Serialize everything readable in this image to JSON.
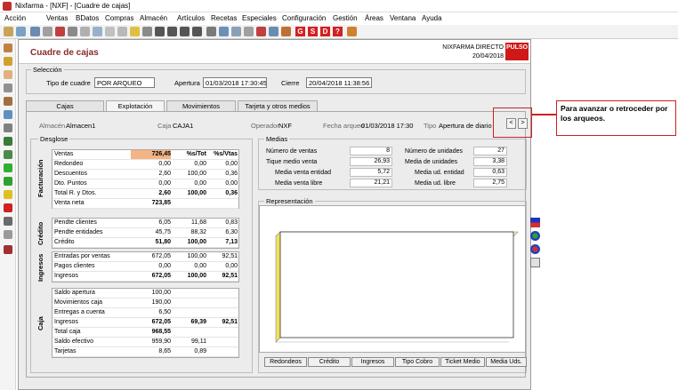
{
  "window": {
    "title": "Nixfarma - [NXF] - [Cuadre de cajas]"
  },
  "menu": [
    "Acción",
    "Ventas",
    "BDatos",
    "Compras",
    "Almacén",
    "Artículos",
    "Recetas",
    "Especiales",
    "Configuración",
    "Gestión",
    "Áreas",
    "Ventana",
    "Ayuda"
  ],
  "toolbar": {
    "red_buttons": [
      "G",
      "S",
      "D",
      "?"
    ]
  },
  "header": {
    "title": "Cuadre de cajas",
    "company": "NIXFARMA DIRECTO",
    "date": "20/04/2018",
    "logo": "PULSO"
  },
  "seleccion": {
    "legend": "Selección",
    "tipo_label": "Tipo de cuadre",
    "tipo_value": "POR ARQUEO",
    "apertura_label": "Apertura",
    "apertura_value": "01/03/2018 17:30:45",
    "cierre_label": "Cierre",
    "cierre_value": "20/04/2018 11:38:56"
  },
  "tabs": [
    "Cajas",
    "Explotación",
    "Movimientos",
    "Tarjeta y otros medios"
  ],
  "info": {
    "almacen_label": "Almacén",
    "almacen": "Almacen1",
    "caja_label": "Caja",
    "caja": "CAJA1",
    "operador_label": "Operador",
    "operador": "NXF",
    "fecha_label": "Fecha arqueo",
    "fecha": "01/03/2018 17:30",
    "tipo_label": "Tipo",
    "tipo": "Apertura de diario"
  },
  "nav": {
    "prev": "<",
    "next": ">"
  },
  "callout": {
    "text": "Para avanzar o retroceder por los arqueos."
  },
  "desglose": {
    "legend": "Desglose",
    "columns": [
      "%s/Tot",
      "%s/Vtas"
    ],
    "groups": {
      "facturacion": {
        "label": "Facturación",
        "rows": [
          {
            "name": "Ventas",
            "v1": "726,45",
            "v2": "",
            "v3": ""
          },
          {
            "name": "Redondeo",
            "v1": "0,00",
            "v2": "0,00",
            "v3": "0,00"
          },
          {
            "name": "Descuentos",
            "v1": "2,60",
            "v2": "100,00",
            "v3": "0,36"
          },
          {
            "name": "Dto. Puntos",
            "v1": "0,00",
            "v2": "0,00",
            "v3": "0,00"
          },
          {
            "name": "Total R. y Dtos.",
            "v1": "2,60",
            "v2": "100,00",
            "v3": "0,36"
          },
          {
            "name": "Venta neta",
            "v1": "723,85",
            "v2": "",
            "v3": ""
          }
        ]
      },
      "credito": {
        "label": "Crédito",
        "rows": [
          {
            "name": "Pendte clientes",
            "v1": "6,05",
            "v2": "11,68",
            "v3": "0,83"
          },
          {
            "name": "Pendte entidades",
            "v1": "45,75",
            "v2": "88,32",
            "v3": "6,30"
          },
          {
            "name": "Crédito",
            "v1": "51,80",
            "v2": "100,00",
            "v3": "7,13"
          }
        ]
      },
      "ingresos": {
        "label": "Ingresos",
        "rows": [
          {
            "name": "Entradas por ventas",
            "v1": "672,05",
            "v2": "100,00",
            "v3": "92,51"
          },
          {
            "name": "Pagos clientes",
            "v1": "0,00",
            "v2": "0,00",
            "v3": "0,00"
          },
          {
            "name": "Ingresos",
            "v1": "672,05",
            "v2": "100,00",
            "v3": "92,51"
          }
        ]
      },
      "caja": {
        "label": "Caja",
        "rows": [
          {
            "name": "Saldo apertura",
            "v1": "100,00",
            "v2": "",
            "v3": ""
          },
          {
            "name": "Movimientos caja",
            "v1": "190,00",
            "v2": "",
            "v3": ""
          },
          {
            "name": "Entregas a cuenta",
            "v1": "6,50",
            "v2": "",
            "v3": ""
          },
          {
            "name": "Ingresos",
            "v1": "672,05",
            "v2": "69,39",
            "v3": "92,51"
          },
          {
            "name": "Total caja",
            "v1": "968,55",
            "v2": "",
            "v3": ""
          },
          {
            "name": "Saldo efectivo",
            "v1": "959,90",
            "v2": "99,11",
            "v3": ""
          },
          {
            "name": "Tarjetas",
            "v1": "8,65",
            "v2": "0,89",
            "v3": ""
          }
        ]
      }
    }
  },
  "medias": {
    "legend": "Medias",
    "left": [
      {
        "label": "Número de ventas",
        "value": "8"
      },
      {
        "label": "Tique medio venta",
        "value": "26,93"
      },
      {
        "label": "Media venta entidad",
        "value": "5,72"
      },
      {
        "label": "Media venta libre",
        "value": "21,21"
      }
    ],
    "right": [
      {
        "label": "Número de unidades",
        "value": "27"
      },
      {
        "label": "Media de unidades",
        "value": "3,38"
      },
      {
        "label": "Media ud. entidad",
        "value": "0,63"
      },
      {
        "label": "Media ud. libre",
        "value": "2,75"
      }
    ]
  },
  "representacion": {
    "legend": "Representación",
    "buttons": [
      "Redondeos",
      "Crédito",
      "Ingresos",
      "Tipo Cobro",
      "Ticket Medio",
      "Media Uds."
    ]
  }
}
